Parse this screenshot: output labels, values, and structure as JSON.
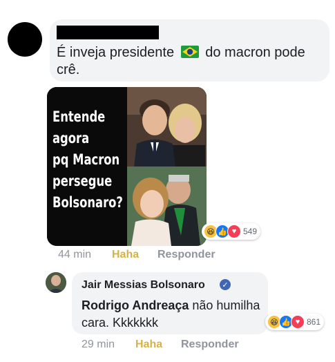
{
  "comment1": {
    "text_before_flag": "É inveja presidente",
    "flag_icon": "brazil-flag-icon",
    "text_after_flag": "do macron pode crê.",
    "reaction_count": "549",
    "time": "44 min",
    "haha_label": "Haha",
    "reply_label": "Responder"
  },
  "meme": {
    "lines": [
      "Entende",
      "agora",
      "pq Macron",
      "persegue",
      "Bolsonaro?"
    ]
  },
  "reply": {
    "author": "Jair Messias Bolsonaro",
    "mention": "Rodrigo Andreaça",
    "text": "não humilha cara. Kkkkkkk",
    "reaction_count": "861",
    "time": "29 min",
    "haha_label": "Haha",
    "reply_label": "Responder"
  },
  "colors": {
    "bubble": "#f2f3f5",
    "haha_link": "#d4b24a",
    "meta_gray": "#90949c",
    "verified": "#4267b2"
  }
}
